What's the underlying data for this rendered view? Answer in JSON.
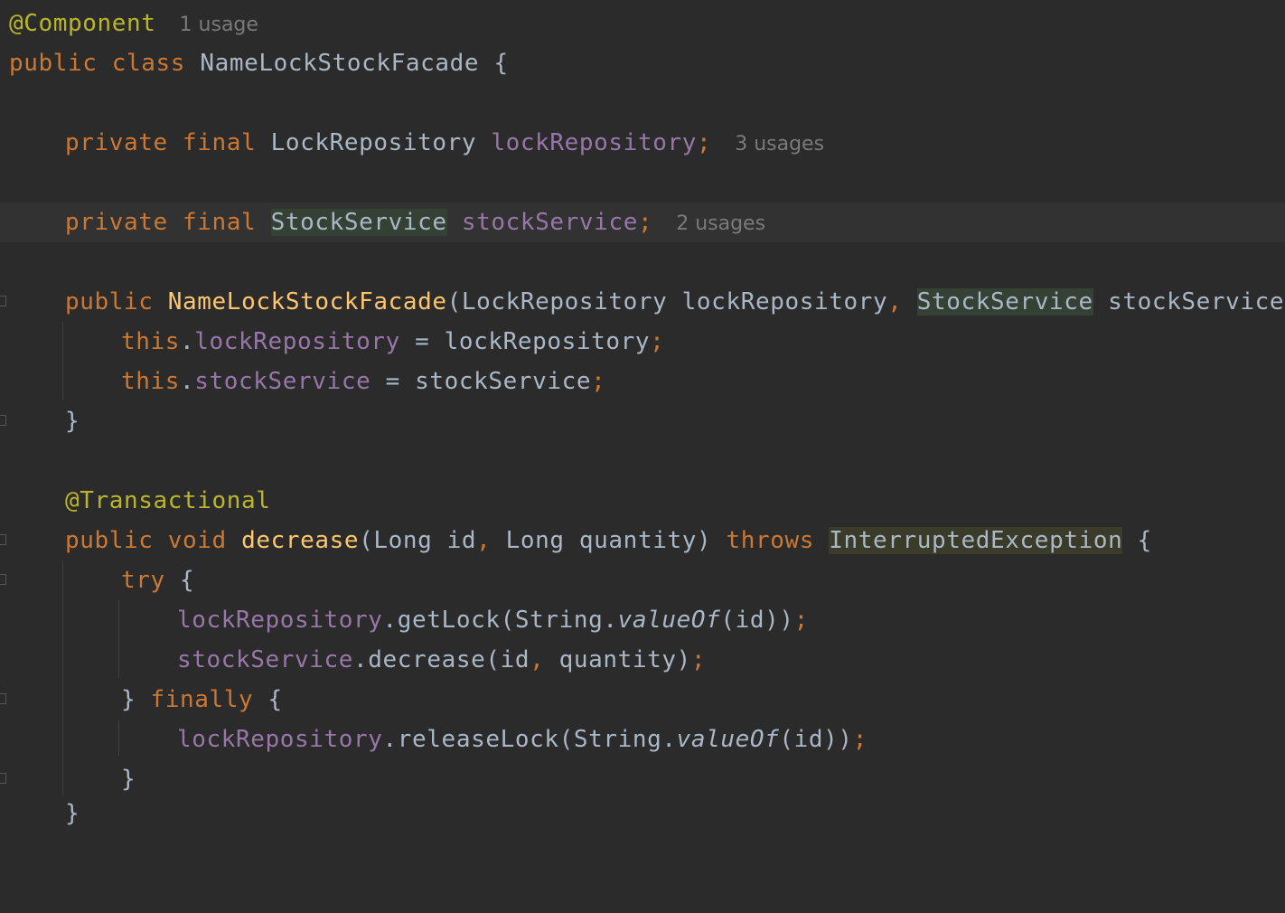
{
  "editor": {
    "line1": {
      "annotation": "@Component",
      "hint": "1 usage"
    },
    "line2": {
      "kw_public": "public",
      "kw_class": "class",
      "class_name": "NameLockStockFacade",
      "brace": "{"
    },
    "line4": {
      "kw_private": "private",
      "kw_final": "final",
      "type": "LockRepository",
      "field": "lockRepository",
      "semi": ";",
      "hint": "3 usages"
    },
    "line6": {
      "kw_private": "private",
      "kw_final": "final",
      "type": "StockService",
      "field": "stockService",
      "semi": ";",
      "hint": "2 usages"
    },
    "line8": {
      "kw_public": "public",
      "method": "NameLockStockFacade",
      "p1": "(LockRepository lockRepository",
      "comma": ",",
      "type2": "StockService",
      "p2": " stockService) {"
    },
    "line9": {
      "kw_this": "this",
      "dot": ".",
      "field": "lockRepository",
      "rest": " = lockRepository",
      "semi": ";"
    },
    "line10": {
      "kw_this": "this",
      "dot": ".",
      "field": "stockService",
      "rest": " = stockService",
      "semi": ";"
    },
    "line11": {
      "brace": "}"
    },
    "line13": {
      "annotation": "@Transactional"
    },
    "line14": {
      "kw_public": "public",
      "kw_void": "void",
      "method": "decrease",
      "p1": "(Long id",
      "comma": ",",
      "p2": " Long quantity) ",
      "kw_throws": "throws",
      "exception": "InterruptedException",
      "brace": " {"
    },
    "line15": {
      "kw_try": "try",
      "brace": " {"
    },
    "line16": {
      "field": "lockRepository",
      "call": ".getLock(String.",
      "italic": "valueOf",
      "args": "(id))",
      "semi": ";"
    },
    "line17": {
      "field": "stockService",
      "call": ".decrease(id",
      "comma": ",",
      "args": " quantity)",
      "semi": ";"
    },
    "line18": {
      "brace": "} ",
      "kw_finally": "finally",
      "brace2": " {"
    },
    "line19": {
      "field": "lockRepository",
      "call": ".releaseLock(String.",
      "italic": "valueOf",
      "args": "(id))",
      "semi": ";"
    },
    "line20": {
      "brace": "}"
    },
    "line21": {
      "brace": "}"
    }
  }
}
